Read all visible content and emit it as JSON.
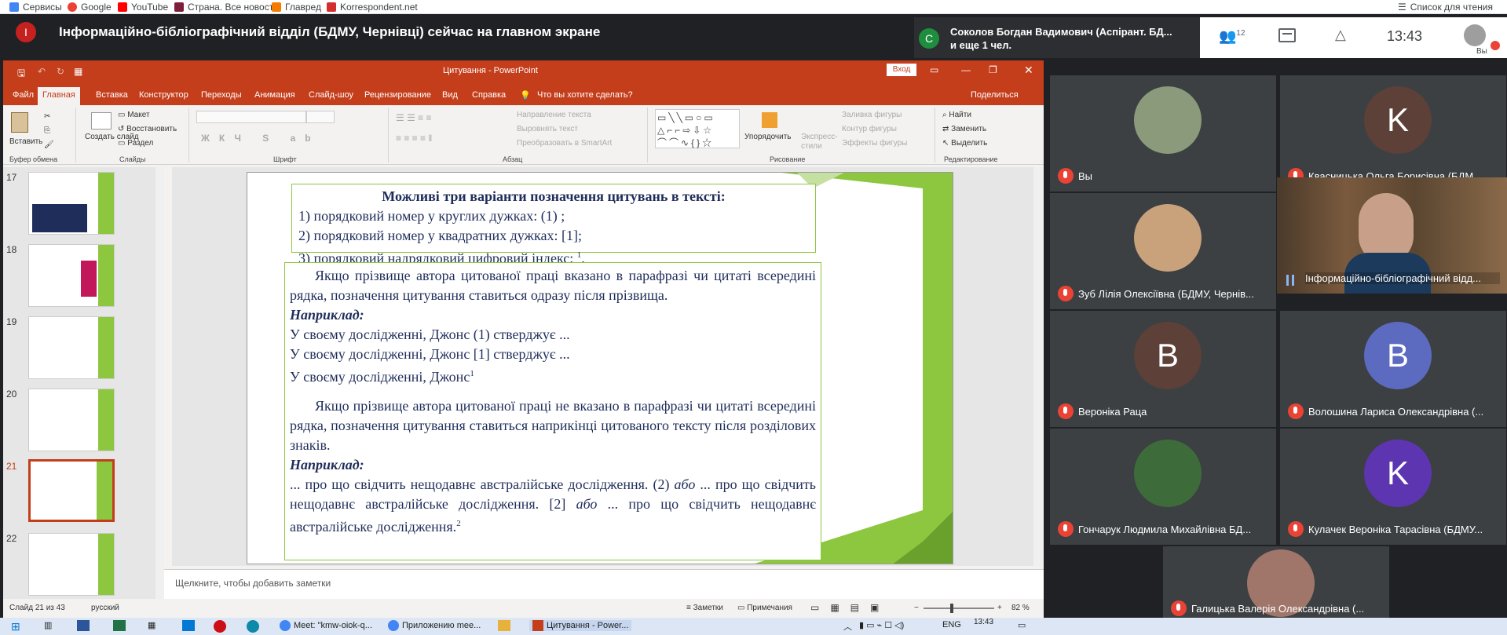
{
  "bookmarks": [
    "Сервисы",
    "Google",
    "YouTube",
    "Страна. Все новост...",
    "Главред",
    "Korrespondent.net"
  ],
  "reading_list": "Список для чтения",
  "meet": {
    "presenter_initial": "І",
    "presenter_title": "Інформаційно-бібліографічний відділ (БДМУ, Чернівці) сейчас на главном экране",
    "speaker_initial": "С",
    "speaker_name": "Соколов Богдан Вадимович (Аспірант. БД...",
    "speaker_more": "и еще 1 чел.",
    "people_count": "12",
    "time": "13:43",
    "you_label": "Вы"
  },
  "ppt": {
    "title": "Цитування  -  PowerPoint",
    "login": "Вход",
    "tabs": [
      "Файл",
      "Главная",
      "Вставка",
      "Конструктор",
      "Переходы",
      "Анимация",
      "Слайд-шоу",
      "Рецензирование",
      "Вид",
      "Справка"
    ],
    "tell_me": "Что вы хотите сделать?",
    "share": "Поделиться",
    "ribbon": {
      "paste": "Вставить",
      "layout": "Макет",
      "reset": "Восстановить",
      "new_slide": "Создать слайд",
      "section": "Раздел",
      "text_dir": "Направление текста",
      "align_text": "Выровнять текст",
      "smartart": "Преобразовать в SmartArt",
      "arrange": "Упорядочить",
      "quick_styles": "Экспресс-стили",
      "fill": "Заливка фигуры",
      "outline": "Контур фигуры",
      "effects": "Эффекты фигуры",
      "find": "Найти",
      "replace": "Заменить",
      "select": "Выделить",
      "groups": [
        "Буфер обмена",
        "Слайды",
        "Шрифт",
        "Абзац",
        "Рисование",
        "Редактирование"
      ]
    },
    "thumb_numbers": [
      "17",
      "18",
      "19",
      "20",
      "21",
      "22"
    ],
    "notes_placeholder": "Щелкните, чтобы добавить заметки",
    "status": {
      "slide": "Слайд 21 из 43",
      "lang": "русский",
      "notes": "Заметки",
      "comments": "Примечания",
      "zoom": "82 %"
    },
    "slide": {
      "box1_title": "Можливі три варіанти позначення цитувань в тексті:",
      "box1_lines": [
        "1) порядковий номер у круглих дужках: (1) ;",
        "2) порядковий номер у квадратних дужках: [1];",
        "3) порядковий надрядковий цифровий індекс: "
      ],
      "sup1": "1",
      "box1_end": ".",
      "p1": "Якщо прізвище автора цитованої праці вказано в парафразі чи цитаті всередині рядка, позначення цитування ставиться одразу після прізвища.",
      "example": "Наприклад:",
      "ex1": "У своєму дослідженні, Джонс (1) стверджує ...",
      "ex2": "У своєму дослідженні, Джонс [1] стверджує ...",
      "ex3": "У своєму дослідженні, Джонс",
      "p2": "Якщо прізвище автора цитованої праці не вказано в парафразі чи цитаті всередині рядка, позначення цитування ставиться наприкінці цитованого тексту після розділових знаків.",
      "c1": "... про що свідчить нещодавнє австралійське дослідження. (2) ",
      "abo": "або",
      "c2": " ... про що свідчить нещодавнє австралійське дослідження. [2] ",
      "c3": " ... про що свідчить нещодавнє австралійське дослідження.",
      "sup2": "2"
    }
  },
  "participants": [
    {
      "name": "Вы",
      "initial": "",
      "color": "#8a9a7a"
    },
    {
      "name": "Квасницька Ольга Борисівна (БДМ...",
      "initial": "K",
      "color": "#5d4037"
    },
    {
      "name": "Зуб Лілія Олексіївна (БДМУ, Чернів...",
      "initial": "",
      "color": "#c9a27c"
    },
    {
      "name": "Інформаційно-бібліографічний відд...",
      "initial": "",
      "color": "#6b4e37"
    },
    {
      "name": "Вероніка Раца",
      "initial": "B",
      "color": "#5d4037"
    },
    {
      "name": "Волошина Лариса Олександрівна (...",
      "initial": "B",
      "color": "#5c6bc0"
    },
    {
      "name": "Гончарук Людмила Михайлівна БД...",
      "initial": "",
      "color": "#3e6b3a"
    },
    {
      "name": "Кулачек Вероніка Тарасівна (БДМУ...",
      "initial": "K",
      "color": "#5e35b1"
    },
    {
      "name": "Галицька Валерія Олександрівна (...",
      "initial": "",
      "color": "#a0766a"
    }
  ],
  "taskbar": {
    "items": [
      "Meet: \"kmw-oiok-q...",
      "Приложению mee...",
      "Цитування - Power..."
    ],
    "lang": "ENG",
    "time": "13:43"
  }
}
